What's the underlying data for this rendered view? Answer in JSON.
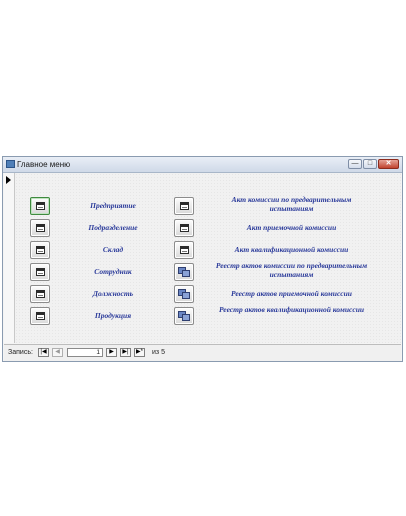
{
  "window": {
    "title": "Главное меню",
    "controls": {
      "minimize": "—",
      "maximize": "□",
      "close": "✕"
    }
  },
  "forms": [
    {
      "label": "Предприятие",
      "icon": "form-icon"
    },
    {
      "label": "Подразделение",
      "icon": "form-icon"
    },
    {
      "label": "Склад",
      "icon": "form-icon"
    },
    {
      "label": "Сотрудник",
      "icon": "form-icon"
    },
    {
      "label": "Должность",
      "icon": "form-icon"
    },
    {
      "label": "Продукция",
      "icon": "form-icon"
    }
  ],
  "reports": [
    {
      "label": "Акт комиссии по предварительным испытаниям",
      "icon": "form-icon"
    },
    {
      "label": "Акт приемочной комиссии",
      "icon": "form-icon"
    },
    {
      "label": "Акт квалификационной комиссии",
      "icon": "form-icon"
    },
    {
      "label": "Реестр актов комиссии по предварительным испытаниям",
      "icon": "report-icon"
    },
    {
      "label": "Реестр актов приемочной комиссии",
      "icon": "report-icon"
    },
    {
      "label": "Реестр актов квалификационной комиссии",
      "icon": "report-icon"
    }
  ],
  "navigator": {
    "label": "Запись:",
    "first": "|◀",
    "prev": "◀",
    "current": "1",
    "next": "▶",
    "last": "▶|",
    "new": "▶*",
    "of_label": "из 5"
  }
}
